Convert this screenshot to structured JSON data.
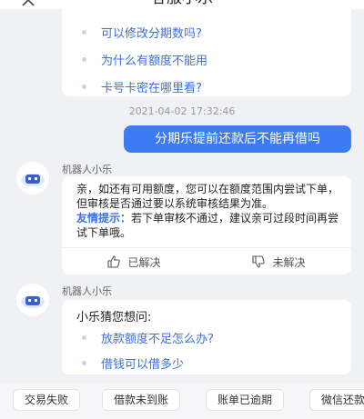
{
  "header": {
    "title": "客服小乐"
  },
  "faq": {
    "items": [
      {
        "label": "可以修改分期数吗?"
      },
      {
        "label": "为什么有额度不能用"
      },
      {
        "label": "卡号卡密在哪里看?"
      }
    ]
  },
  "timestamp": "2021-04-02 17:32:46",
  "user_message": "分期乐提前还款后不能再借吗",
  "bot_name": "机器人小乐",
  "answer": {
    "text": "亲，如还有可用额度，您可以在额度范围内尝试下单，但审核是否通过要以系统审核结果为准。",
    "tip_label": "友情提示：",
    "tip_text": "若下单审核不通过，建议亲可过段时间再尝试下单哦。",
    "resolved_label": "已解决",
    "unresolved_label": "未解决"
  },
  "guess": {
    "title": "小乐猜您想问:",
    "items": [
      {
        "label": "放款额度不足怎么办?"
      },
      {
        "label": "借钱可以借多少"
      }
    ]
  },
  "quick_replies": [
    {
      "label": "交易失败"
    },
    {
      "label": "借款未到账"
    },
    {
      "label": "账单已逾期"
    },
    {
      "label": "微信还款"
    }
  ],
  "colors": {
    "accent": "#3d7bf5",
    "link": "#3d6fe8",
    "background": "#f0f1f5"
  },
  "icons": {
    "back": "close-icon",
    "avatar": "robot-icon",
    "resolved": "thumbs-up-icon",
    "unresolved": "thumbs-down-icon"
  }
}
